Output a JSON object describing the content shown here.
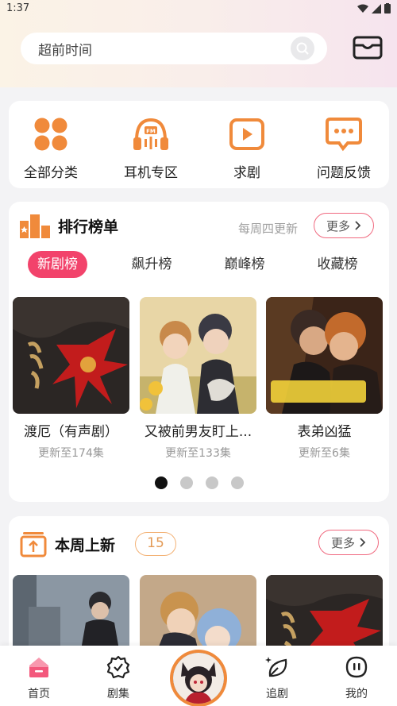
{
  "status": {
    "time": "1:37"
  },
  "search": {
    "placeholder": "超前时间"
  },
  "quick_links": [
    {
      "label": "全部分类",
      "icon": "grid-icon"
    },
    {
      "label": "耳机专区",
      "icon": "headphones-icon"
    },
    {
      "label": "求剧",
      "icon": "play-icon"
    },
    {
      "label": "问题反馈",
      "icon": "feedback-icon"
    }
  ],
  "ranking": {
    "title": "排行榜单",
    "update_note": "每周四更新",
    "more_label": "更多",
    "tabs": [
      "新剧榜",
      "飙升榜",
      "巅峰榜",
      "收藏榜"
    ],
    "active_tab": 0,
    "items": [
      {
        "name": "渡厄（有声剧）",
        "episodes": "更新至174集"
      },
      {
        "name": "又被前男友盯上...",
        "episodes": "更新至133集"
      },
      {
        "name": "表弟凶猛",
        "episodes": "更新至6集"
      }
    ],
    "pages": 4,
    "current_page": 0
  },
  "weekly": {
    "title": "本周上新",
    "count": "15",
    "more_label": "更多"
  },
  "bottom_nav": [
    {
      "label": "首页",
      "icon": "home-icon"
    },
    {
      "label": "剧集",
      "icon": "drama-icon"
    },
    {
      "label": "追剧",
      "icon": "follow-icon"
    },
    {
      "label": "我的",
      "icon": "profile-icon"
    }
  ],
  "colors": {
    "accent": "#f2436b",
    "orange": "#f08a3b"
  }
}
